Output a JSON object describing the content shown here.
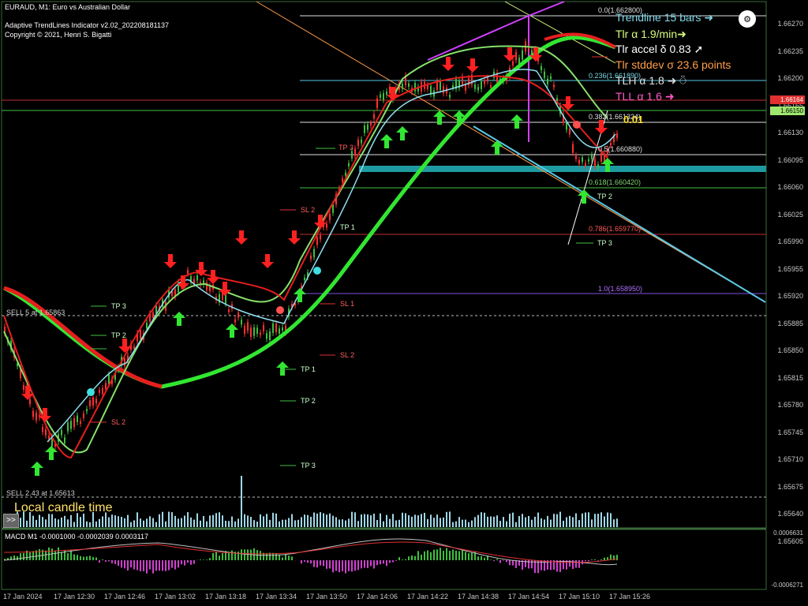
{
  "header": {
    "symbol_line": "EURAUD, M1:  Euro vs Australian Dollar",
    "indicator_line": "Adaptive TrendLines Indicator v2.02_202208181137",
    "copyright_line": "Copyright © 2021, Henri S. Bigatti"
  },
  "info_panel": [
    {
      "text": "Trendline 15 bars ➜",
      "color": "#7fd8e8"
    },
    {
      "text": "Tlr α 1.9/min➜",
      "color": "#d8ff7f"
    },
    {
      "text": "Tlr accel δ 0.83 ➚",
      "color": "#ffffff"
    },
    {
      "text": "Tlr stddev σ 23.6 points",
      "color": "#ff9f4a"
    },
    {
      "text": "TLH α 1.8 ➜ ⍥",
      "color": "#e0e0e0"
    },
    {
      "text": "TLL α 1.6 ➜",
      "color": "#ff5ac8"
    }
  ],
  "price_labels": [
    "1.66270",
    "1.66235",
    "1.66200",
    "1.66165",
    "1.66130",
    "1.66095",
    "1.66060",
    "1.66025",
    "1.65990",
    "1.65955",
    "1.65920",
    "1.65885",
    "1.65850",
    "1.65815",
    "1.65780",
    "1.65745",
    "1.65710",
    "1.65675",
    "1.65640",
    "1.65605"
  ],
  "price_badges": [
    {
      "text": "1.66164",
      "color": "#e03030"
    },
    {
      "text": "1.66150",
      "color": "#9fe870"
    }
  ],
  "fib_levels": [
    {
      "text": "0.0(1.662800)",
      "color": "#e0e0e0"
    },
    {
      "text": "0.236(1.661890)",
      "color": "#7fd8e8"
    },
    {
      "text": "0.382(1.661324)",
      "color": "#e0e0e0"
    },
    {
      "text": "0.5(1.660880)",
      "color": "#e0e0e0"
    },
    {
      "text": "0.618(1.660420)",
      "color": "#7fd870"
    },
    {
      "text": "0.786(1.659770)",
      "color": "#ff5a5a"
    },
    {
      "text": "1.0(1.658950)",
      "color": "#b070ff"
    }
  ],
  "value_tag": "0.01",
  "sell_labels": [
    "SELL 5 at 1.65863",
    "SELL 2.43 at 1.65613"
  ],
  "signal_tags": {
    "tp1": "TP 1",
    "tp2": "TP 2",
    "tp3": "TP 3",
    "sl1": "SL 1",
    "sl2": "SL 2"
  },
  "local_candle_time": "Local candle time",
  "toggle_button": ">>",
  "macd": {
    "label": "MACD M1 -0.0001000 -0.0002039 0.0003117",
    "top_value": "0.0006631",
    "bottom_value": "-0.0006271"
  },
  "time_labels": [
    "17 Jan 2024",
    "17 Jan 12:30",
    "17 Jan 12:46",
    "17 Jan 13:02",
    "17 Jan 13:18",
    "17 Jan 13:34",
    "17 Jan 13:50",
    "17 Jan 14:06",
    "17 Jan 14:22",
    "17 Jan 14:38",
    "17 Jan 14:54",
    "17 Jan 15:10",
    "17 Jan 15:26"
  ],
  "colors": {
    "background": "#000000",
    "grid": "#1e3a1e",
    "bull_candle": "#3fbf3f",
    "bear_candle": "#ff3030",
    "ma_green": "#32e632",
    "ma_red": "#e61e1e",
    "channel_cyan": "#59c9e6",
    "signal_up": "#32e632",
    "signal_down": "#ff2020"
  }
}
